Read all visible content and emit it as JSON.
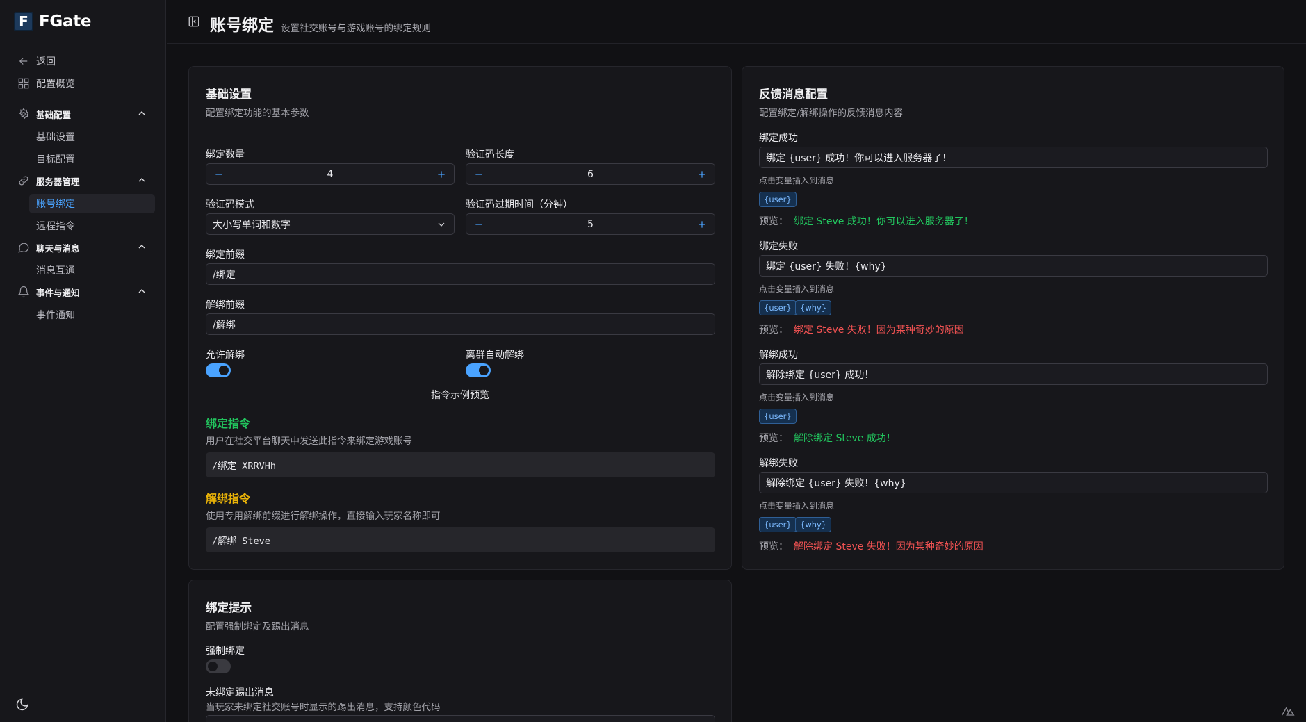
{
  "app": {
    "logo_letter": "F",
    "name": "FGate"
  },
  "sidebar": {
    "back": "返回",
    "overview": "配置概览",
    "groups": [
      {
        "label": "基础配置",
        "items": [
          "基础设置",
          "目标配置"
        ]
      },
      {
        "label": "服务器管理",
        "items": [
          "账号绑定",
          "远程指令"
        ]
      },
      {
        "label": "聊天与消息",
        "items": [
          "消息互通"
        ]
      },
      {
        "label": "事件与通知",
        "items": [
          "事件通知"
        ]
      }
    ],
    "active_item": "账号绑定"
  },
  "header": {
    "title": "账号绑定",
    "subtitle": "设置社交账号与游戏账号的绑定规则"
  },
  "basic": {
    "title": "基础设置",
    "desc": "配置绑定功能的基本参数",
    "bind_count_label": "绑定数量",
    "bind_count": "4",
    "code_length_label": "验证码长度",
    "code_length": "6",
    "code_mode_label": "验证码模式",
    "code_mode": "大小写单词和数字",
    "code_expire_label": "验证码过期时间（分钟）",
    "code_expire": "5",
    "bind_prefix_label": "绑定前缀",
    "bind_prefix": "/绑定",
    "unbind_prefix_label": "解绑前缀",
    "unbind_prefix": "/解绑",
    "allow_unbind_label": "允许解绑",
    "allow_unbind": true,
    "auto_unbind_label": "离群自动解绑",
    "auto_unbind": true,
    "preview_divider": "指令示例预览",
    "bind_cmd_title": "绑定指令",
    "bind_cmd_desc": "用户在社交平台聊天中发送此指令来绑定游戏账号",
    "bind_cmd_example": "/绑定 XRRVHh",
    "unbind_cmd_title": "解绑指令",
    "unbind_cmd_desc": "使用专用解绑前缀进行解绑操作，直接输入玩家名称即可",
    "unbind_cmd_example": "/解绑 Steve"
  },
  "feedback": {
    "title": "反馈消息配置",
    "desc": "配置绑定/解绑操作的反馈消息内容",
    "insert_hint": "点击变量插入到消息",
    "preview_label": "预览：",
    "items": [
      {
        "label": "绑定成功",
        "value": "绑定 {user} 成功！你可以进入服务器了！",
        "vars": [
          "{user}"
        ],
        "preview": "绑定 Steve 成功！你可以进入服务器了！",
        "ok": true
      },
      {
        "label": "绑定失败",
        "value": "绑定 {user} 失败！{why}",
        "vars": [
          "{user}",
          "{why}"
        ],
        "preview": "绑定 Steve 失败！因为某种奇妙的原因",
        "ok": false
      },
      {
        "label": "解绑成功",
        "value": "解除绑定 {user} 成功！",
        "vars": [
          "{user}"
        ],
        "preview": "解除绑定 Steve 成功！",
        "ok": true
      },
      {
        "label": "解绑失败",
        "value": "解除绑定 {user} 失败！{why}",
        "vars": [
          "{user}",
          "{why}"
        ],
        "preview": "解除绑定 Steve 失败！因为某种奇妙的原因",
        "ok": false
      }
    ]
  },
  "hint": {
    "title": "绑定提示",
    "desc": "配置强制绑定及踢出消息",
    "force_label": "强制绑定",
    "force": false,
    "kick_label": "未绑定踢出消息",
    "kick_desc": "当玩家未绑定社交账号时显示的踢出消息，支持颜色代码"
  },
  "colors": {
    "accent": "#4aa3ff",
    "success": "#22c55e",
    "warning": "#eab308",
    "error": "#f05252"
  }
}
